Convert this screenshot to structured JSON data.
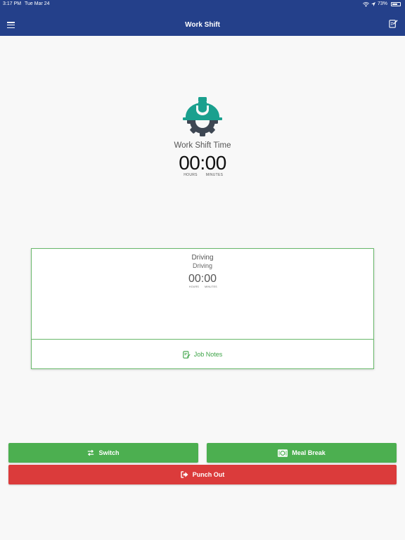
{
  "status_bar": {
    "time": "3:17 PM",
    "date": "Tue Mar 24",
    "battery": "73%",
    "battery_level": 0.73,
    "icons": [
      "wifi-icon",
      "location-arrow-icon",
      "battery-icon"
    ]
  },
  "header": {
    "title": "Work Shift",
    "left_icon": "menu-icon",
    "right_icon": "notes-edit-icon"
  },
  "shift": {
    "logo_icon": "hard-hat-gear-icon",
    "label": "Work Shift Time",
    "time": "00:00",
    "hours_label": "HOURS",
    "minutes_label": "MINUTES"
  },
  "job_card": {
    "title": "Driving",
    "subtitle": "Driving",
    "time": "00:00",
    "hours_label": "HOURS",
    "minutes_label": "MINUTES",
    "notes_label": "Job Notes",
    "notes_icon": "note-edit-icon"
  },
  "actions": {
    "switch_label": "Switch",
    "switch_icon": "swap-arrows-icon",
    "meal_label": "Meal Break",
    "meal_icon": "plate-cutlery-icon",
    "punch_out_label": "Punch Out",
    "punch_out_icon": "sign-out-icon"
  },
  "colors": {
    "header": "#24408a",
    "green": "#4caf50",
    "red": "#db3b3b",
    "logo_teal": "#1aa08e",
    "logo_dark": "#3e4753"
  }
}
